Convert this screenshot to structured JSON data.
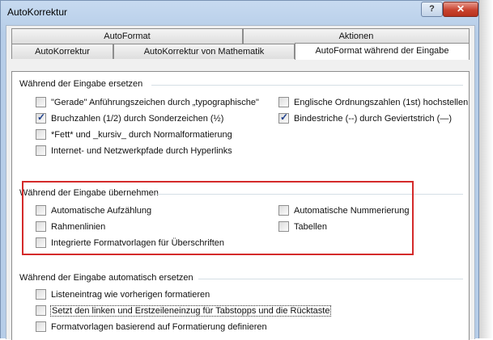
{
  "window": {
    "title": "AutoKorrektur",
    "help_glyph": "?",
    "close_glyph": "✕"
  },
  "tabs": {
    "row_top": [
      "AutoFormat",
      "Aktionen"
    ],
    "row_bottom": [
      "AutoKorrektur",
      "AutoKorrektur von Mathematik",
      "AutoFormat während der Eingabe"
    ],
    "active": "AutoFormat während der Eingabe"
  },
  "groups": [
    {
      "title": "Während der Eingabe ersetzen",
      "items": [
        {
          "label": "\"Gerade\" Anführungszeichen durch „typographische\"",
          "checked": false
        },
        {
          "label": "Englische Ordnungszahlen (1st) hochstellen",
          "checked": false
        },
        {
          "label": "Bruchzahlen (1/2) durch Sonderzeichen (½)",
          "checked": true
        },
        {
          "label": "Bindestriche (--) durch Geviertstrich (—)",
          "checked": true
        },
        {
          "label": "*Fett* und _kursiv_ durch Normalformatierung",
          "checked": false
        },
        {
          "label": "Internet- und Netzwerkpfade durch Hyperlinks",
          "checked": false
        }
      ]
    },
    {
      "title": "Während der Eingabe übernehmen",
      "items": [
        {
          "label": "Automatische Aufzählung",
          "checked": false
        },
        {
          "label": "Automatische Nummerierung",
          "checked": false
        },
        {
          "label": "Rahmenlinien",
          "checked": false
        },
        {
          "label": "Tabellen",
          "checked": false
        },
        {
          "label": "Integrierte Formatvorlagen für Überschriften",
          "checked": false
        }
      ]
    },
    {
      "title": "Während der Eingabe automatisch ersetzen",
      "items": [
        {
          "label": "Listeneintrag wie vorherigen formatieren",
          "checked": false
        },
        {
          "label": "Setzt den linken und Erstzeileneinzug für Tabstopps und die Rücktaste",
          "checked": false
        },
        {
          "label": "Formatvorlagen basierend auf Formatierung definieren",
          "checked": false
        }
      ]
    }
  ],
  "colors": {
    "highlight": "#d42a2a",
    "close_button": "#c9432f",
    "check": "#1c3f8c"
  }
}
